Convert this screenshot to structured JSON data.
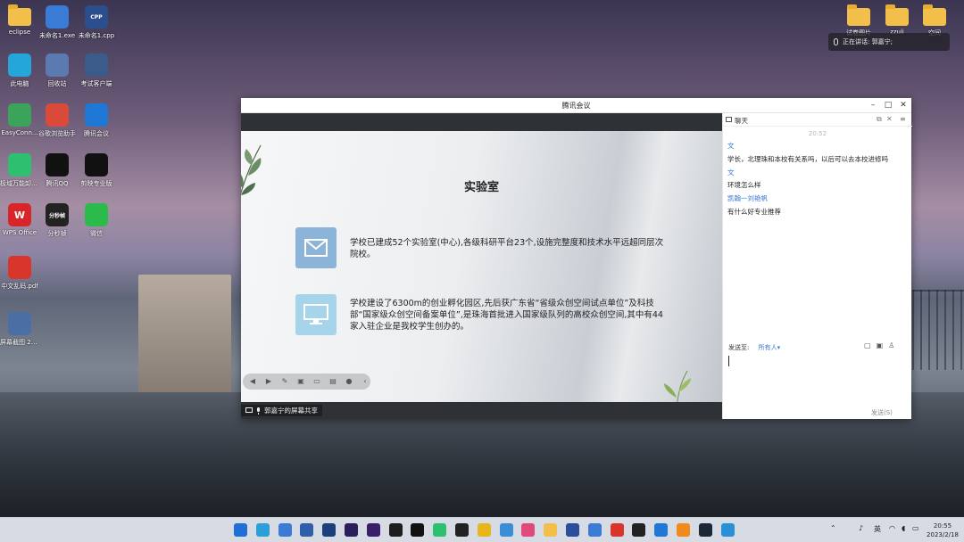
{
  "desktop": {
    "left_icons": [
      {
        "label": "eclipse",
        "kind": "folder"
      },
      {
        "label": "未命名1.exe",
        "kind": "exe"
      },
      {
        "label": "未命名1.cpp",
        "kind": "cpp",
        "badge": "CPP"
      },
      {
        "label": "此电脑",
        "kind": "pc"
      },
      {
        "label": "回收站",
        "kind": "bin"
      },
      {
        "label": "考试客户端",
        "kind": "app"
      },
      {
        "label": "EasyConn...",
        "kind": "app"
      },
      {
        "label": "谷歌浏览助手",
        "kind": "app"
      },
      {
        "label": "腾讯会议",
        "kind": "app"
      },
      {
        "label": "极域万能卸载工具",
        "kind": "app"
      },
      {
        "label": "腾讯QQ",
        "kind": "app"
      },
      {
        "label": "剪映专业版",
        "kind": "app"
      },
      {
        "label": "WPS Office",
        "kind": "app",
        "badge": "W"
      },
      {
        "label": "分秒帧",
        "kind": "app",
        "badge": "分秒帧"
      },
      {
        "label": "微信",
        "kind": "app"
      },
      {
        "label": "中文乱码.pdf",
        "kind": "pdf"
      },
      {
        "label": "屏幕截图 2023-02-1...",
        "kind": "img"
      }
    ],
    "right_icons": [
      {
        "label": "试卷图片"
      },
      {
        "label": "zzuli"
      },
      {
        "label": "空间"
      }
    ]
  },
  "speaking_banner": {
    "text": "正在讲话: 郭嘉宁;"
  },
  "meeting_window": {
    "title": "腾讯会议",
    "controls": {
      "minimize": "–",
      "maximize": "□",
      "close": "✕"
    },
    "slide": {
      "title": "实验室",
      "points": [
        "学校已建成52个实验室(中心),各级科研平台23个,设施完整度和技术水平远超同层次院校。",
        "学校建设了6300m的创业孵化园区,先后获广东省“省级众创空间试点单位”及科技部“国家级众创空间备案单位”,是珠海首批进入国家级队列的高校众创空间,其中有44家入驻企业是我校学生创办的。"
      ]
    },
    "share_label": "郭嘉宁的屏幕共享",
    "chat": {
      "title": "聊天",
      "time": "20:52",
      "messages": [
        {
          "name": "文",
          "text": "学长，北理珠和本校有关系吗，以后可以去本校进修吗"
        },
        {
          "name": "文",
          "text": "环境怎么样"
        },
        {
          "name": "凯翰一刘艳帆",
          "text": "有什么好专业推荐"
        }
      ],
      "send_to_label": "发送至:",
      "send_to_value": "所有人",
      "send_button": "发送(S)"
    }
  },
  "taskbar": {
    "ime": "英",
    "time": "20:55",
    "date": "2023/2/18"
  }
}
